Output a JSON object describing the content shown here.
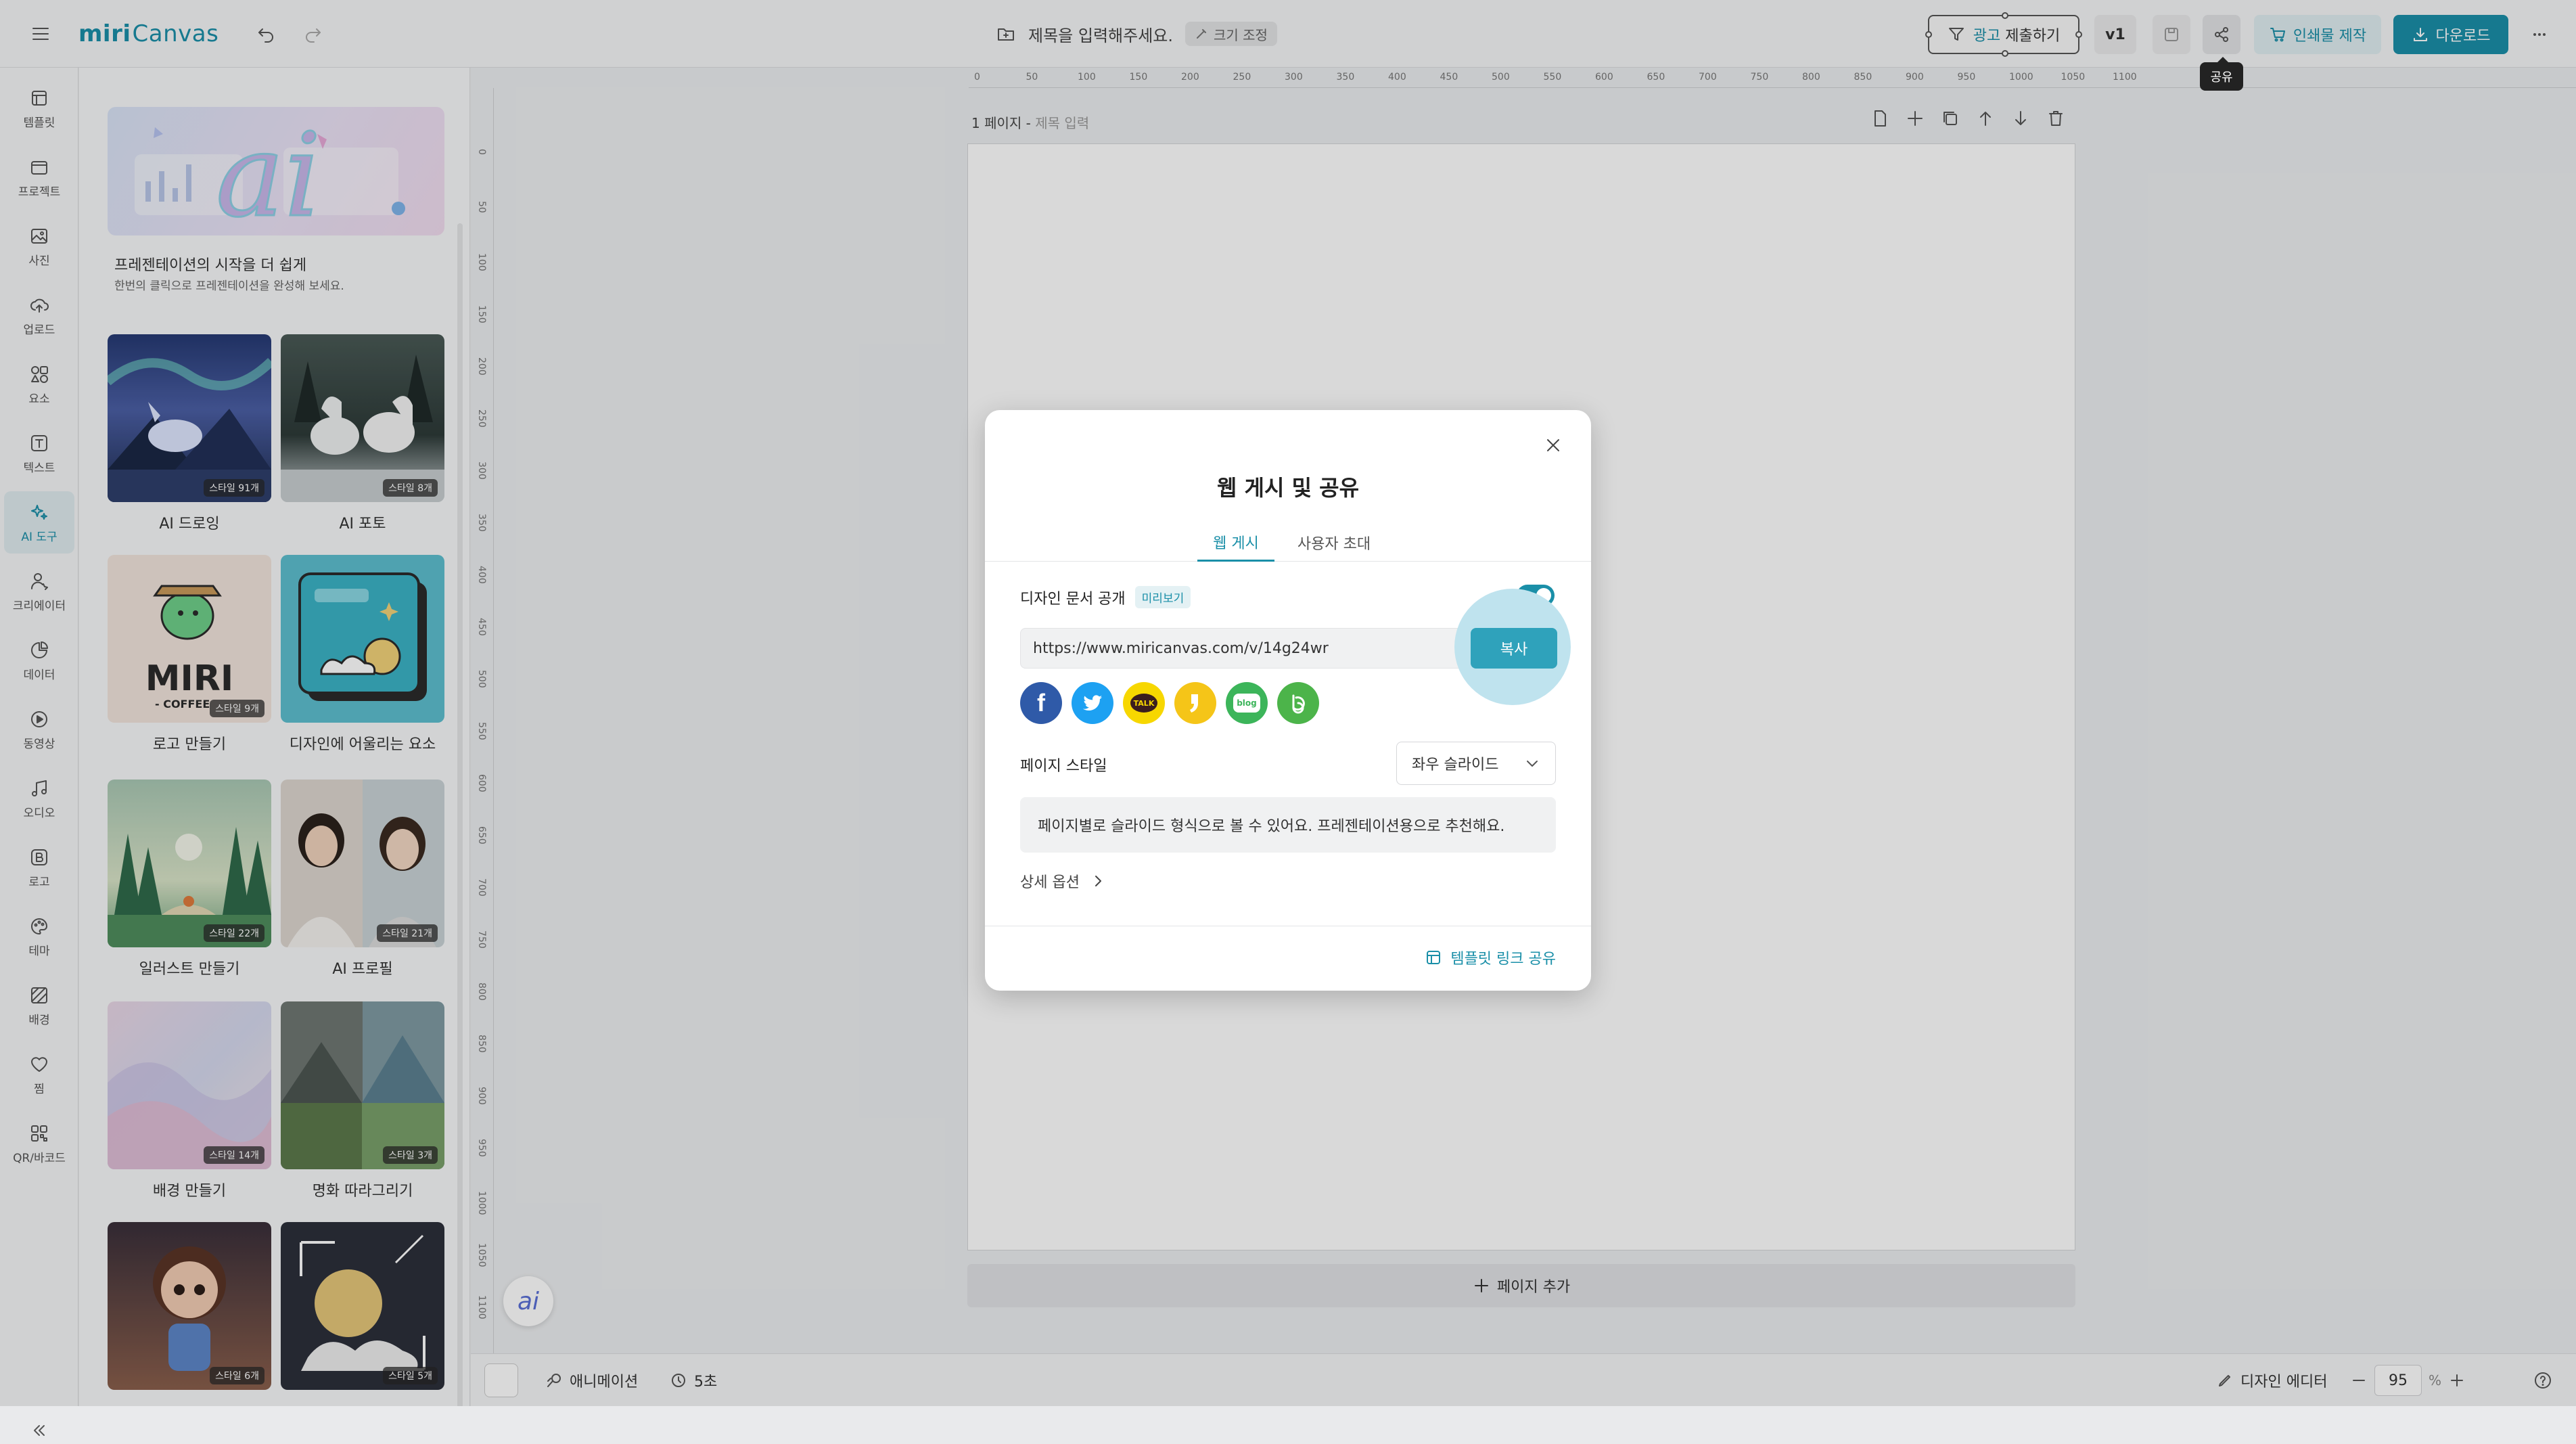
{
  "app": {
    "logo_mark": "miri",
    "logo_text": "Canvas"
  },
  "header": {
    "doc_title_placeholder": "제목을 입력해주세요.",
    "resize_label": "크기 조정",
    "ad_submit_prefix": "광고",
    "ad_submit_label": "제출하기",
    "version": "v1",
    "share_tooltip": "공유",
    "print_label": "인쇄물 제작",
    "download_label": "다운로드"
  },
  "sidebar": {
    "items": [
      {
        "label": "템플릿",
        "icon": "template-icon"
      },
      {
        "label": "프로젝트",
        "icon": "project-icon"
      },
      {
        "label": "사진",
        "icon": "photo-icon"
      },
      {
        "label": "업로드",
        "icon": "upload-icon"
      },
      {
        "label": "요소",
        "icon": "elements-icon"
      },
      {
        "label": "텍스트",
        "icon": "text-icon"
      },
      {
        "label": "AI 도구",
        "icon": "ai-tools-icon",
        "active": true
      },
      {
        "label": "크리에이터",
        "icon": "creator-icon"
      },
      {
        "label": "데이터",
        "icon": "data-icon"
      },
      {
        "label": "동영상",
        "icon": "video-icon"
      },
      {
        "label": "오디오",
        "icon": "audio-icon"
      },
      {
        "label": "로고",
        "icon": "logo-icon"
      },
      {
        "label": "테마",
        "icon": "theme-icon"
      },
      {
        "label": "배경",
        "icon": "background-icon"
      },
      {
        "label": "찜",
        "icon": "heart-icon"
      },
      {
        "label": "QR/바코드",
        "icon": "qr-icon"
      }
    ]
  },
  "panel": {
    "banner_title": "프레젠테이션의 시작을 더 쉽게",
    "banner_sub": "한번의 클릭으로 프레젠테이션을 완성해 보세요.",
    "cards": [
      {
        "label": "AI 드로잉",
        "badge": "스타일 91개"
      },
      {
        "label": "AI 포토",
        "badge": "스타일 8개"
      },
      {
        "label": "로고 만들기",
        "badge": "스타일 9개"
      },
      {
        "label": "디자인에 어울리는 요소",
        "badge": ""
      },
      {
        "label": "일러스트 만들기",
        "badge": "스타일 22개"
      },
      {
        "label": "AI 프로필",
        "badge": "스타일 21개"
      },
      {
        "label": "배경 만들기",
        "badge": "스타일 14개"
      },
      {
        "label": "명화 따라그리기",
        "badge": "스타일 3개"
      },
      {
        "label": "",
        "badge": "스타일 6개"
      },
      {
        "label": "",
        "badge": "스타일 5개"
      }
    ],
    "logo_card_text": "MIRI",
    "logo_card_sub": "- COFFEE"
  },
  "canvas": {
    "ruler_h": [
      "0",
      "50",
      "100",
      "150",
      "200",
      "250",
      "300",
      "350",
      "400",
      "450",
      "500",
      "550",
      "600",
      "650",
      "700",
      "750",
      "800",
      "850",
      "900",
      "950",
      "1000",
      "1050",
      "1100"
    ],
    "ruler_v": [
      "0",
      "50",
      "100",
      "150",
      "200",
      "250",
      "300",
      "350",
      "400",
      "450",
      "500",
      "550",
      "600",
      "650",
      "700",
      "750",
      "800",
      "850",
      "900",
      "950",
      "1000",
      "1050",
      "1100"
    ],
    "page_label": "1 페이지 -",
    "page_title_placeholder": "제목 입력",
    "add_page": "페이지 추가",
    "ai_fab": "ai"
  },
  "bottombar": {
    "animation": "애니메이션",
    "duration": "5초",
    "designer": "디자인 에디터",
    "zoom": "95",
    "zoom_unit": "%"
  },
  "modal": {
    "title": "웹 게시 및 공유",
    "tabs": [
      "웹 게시",
      "사용자 초대"
    ],
    "public_label": "디자인 문서 공개",
    "preview_badge": "미리보기",
    "toggle_on": true,
    "url": "https://www.miricanvas.com/v/14g24wr",
    "copy_label": "복사",
    "socials": [
      {
        "name": "facebook",
        "color": "#2f5aa8",
        "glyph": "f"
      },
      {
        "name": "twitter",
        "color": "#1da1f2",
        "glyph": ""
      },
      {
        "name": "kakaotalk",
        "color": "#f7d700",
        "glyph": "TALK"
      },
      {
        "name": "kakaostory",
        "color": "#f5c518",
        "glyph": ""
      },
      {
        "name": "naver-blog",
        "color": "#3cb55a",
        "glyph": "blog"
      },
      {
        "name": "naver-band",
        "color": "#4cb44a",
        "glyph": ""
      }
    ],
    "page_style_label": "페이지 스타일",
    "page_style_value": "좌우 슬라이드",
    "desc": "페이지별로 슬라이드 형식으로 볼 수 있어요. 프레젠테이션용으로 추천해요.",
    "detail_options": "상세 옵션",
    "template_link": "템플릿 링크 공유"
  }
}
